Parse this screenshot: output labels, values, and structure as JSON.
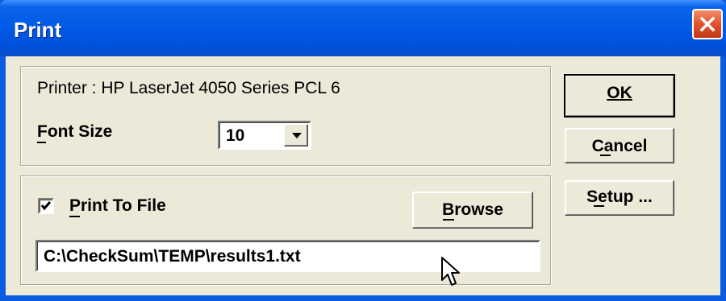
{
  "window": {
    "title": "Print"
  },
  "printer": {
    "label": "Printer : HP LaserJet 4050 Series PCL 6"
  },
  "font_size": {
    "label": "Font Size",
    "value": "10"
  },
  "print_to_file": {
    "label": "Print To File",
    "checked": true
  },
  "buttons": {
    "ok": "OK",
    "cancel": "Cancel",
    "setup": "Setup ...",
    "browse": "Browse"
  },
  "file_path": {
    "value": "C:\\CheckSum\\TEMP\\results1.txt"
  },
  "icons": {
    "close": "close-icon",
    "dropdown": "chevron-down-icon",
    "check": "checkmark-icon",
    "cursor": "mouse-pointer-icon"
  },
  "colors": {
    "titlebar": "#0058e6",
    "dialog_bg": "#ece9d8",
    "close_button": "#e0522a"
  }
}
